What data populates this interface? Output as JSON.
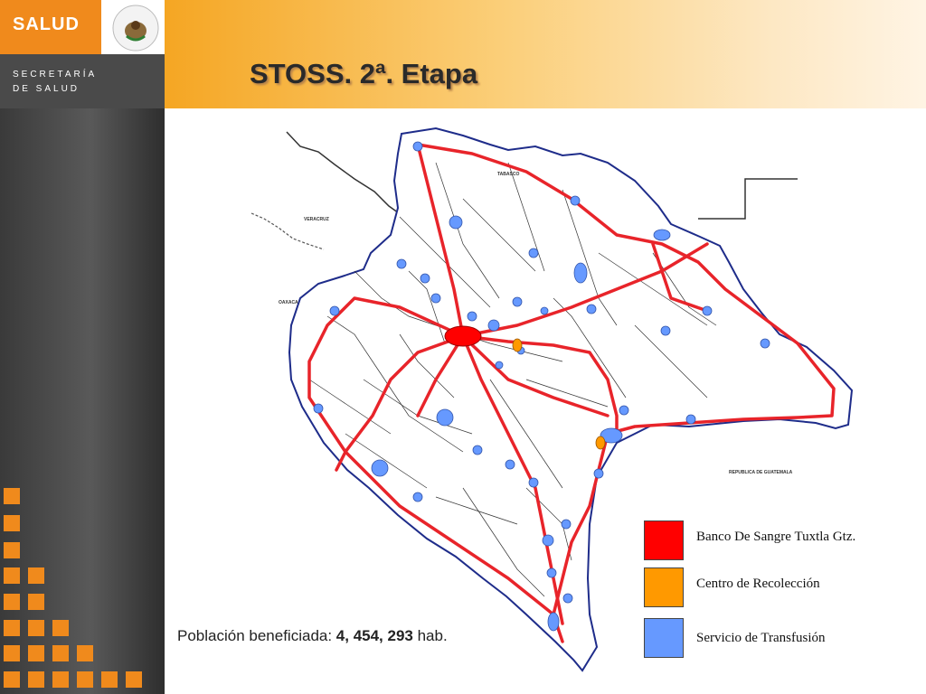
{
  "header": {
    "brand": "SALUD",
    "secretaria_line1": "SECRETARÍA",
    "secretaria_line2": "DE SALUD",
    "title": "STOSS. 2ª. Etapa"
  },
  "colors": {
    "brand_orange": "#f08a1c",
    "route_red": "#e8242a",
    "banco": "#ff0000",
    "centro": "#ff9900",
    "transfusion": "#6699ff"
  },
  "map": {
    "labels": [
      "TABASCO",
      "VERACRUZ",
      "OAXACA",
      "REPUBLICA DE GUATEMALA"
    ]
  },
  "legend": {
    "items": [
      {
        "label": "Banco De Sangre Tuxtla Gtz.",
        "color": "#ff0000"
      },
      {
        "label": "Centro de Recolección",
        "color": "#ff9900"
      },
      {
        "label": "Servicio de Transfusión",
        "color": "#6699ff"
      }
    ]
  },
  "footer": {
    "prefix": "Población beneficiada: ",
    "value": "4, 454, 293",
    "suffix": " hab."
  }
}
